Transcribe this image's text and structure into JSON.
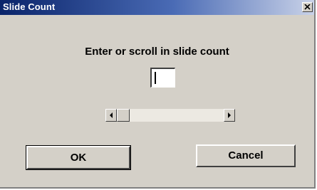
{
  "window": {
    "title": "Slide Count",
    "close_icon": "close-icon"
  },
  "dialog": {
    "prompt": "Enter or scroll in slide count",
    "slide_count_value": "",
    "scroll_position": 0
  },
  "buttons": {
    "ok_label": "OK",
    "cancel_label": "Cancel"
  },
  "colors": {
    "titlebar_start": "#0a246a",
    "titlebar_end": "#c9d2e8",
    "dialog_face": "#d4d0c8"
  }
}
